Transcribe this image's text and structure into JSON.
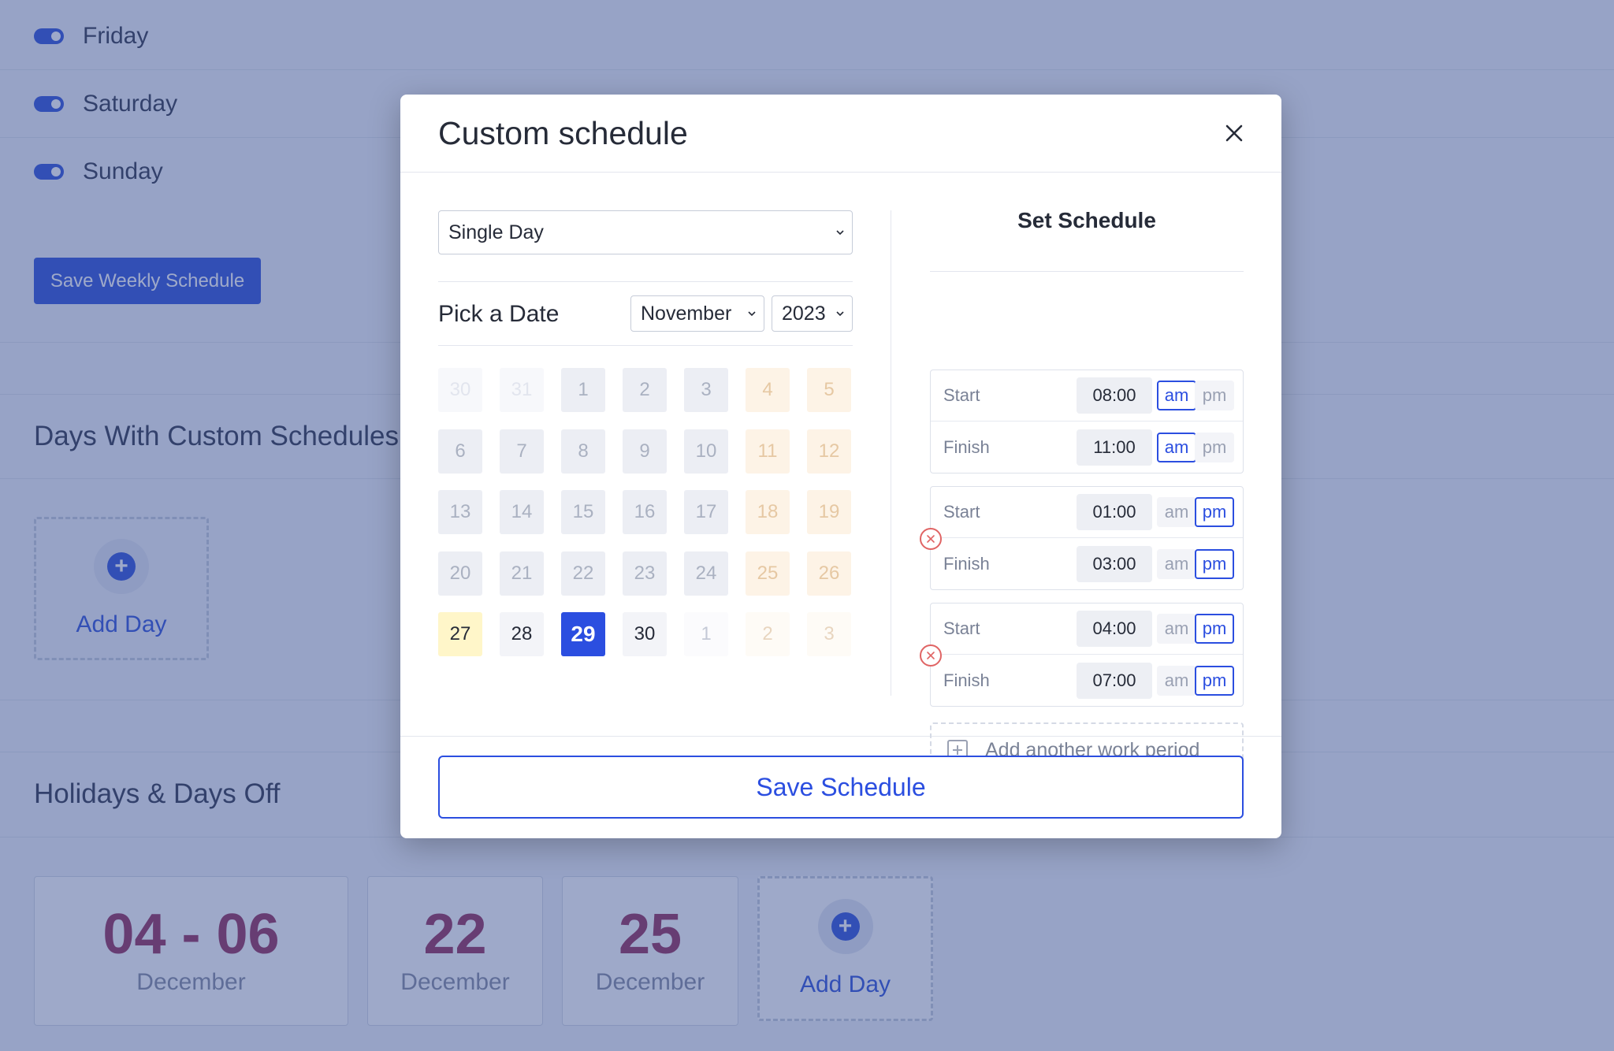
{
  "background": {
    "days": [
      {
        "name": "Friday"
      },
      {
        "name": "Saturday"
      },
      {
        "name": "Sunday"
      }
    ],
    "save_weekly_label": "Save Weekly Schedule",
    "custom_section_title": "Days With Custom Schedules",
    "add_day_label": "Add Day",
    "holidays_title": "Holidays & Days Off",
    "holidays": [
      {
        "num": "04 - 06",
        "month": "December"
      },
      {
        "num": "22",
        "month": "December"
      },
      {
        "num": "25",
        "month": "December"
      }
    ],
    "holiday_add_label": "Add Day"
  },
  "modal": {
    "title": "Custom schedule",
    "mode_select": "Single Day",
    "pick_label": "Pick a Date",
    "month_select": "November",
    "year_select": "2023",
    "calendar": [
      [
        "30",
        "31",
        "1",
        "2",
        "3",
        "4",
        "5"
      ],
      [
        "6",
        "7",
        "8",
        "9",
        "10",
        "11",
        "12"
      ],
      [
        "13",
        "14",
        "15",
        "16",
        "17",
        "18",
        "19"
      ],
      [
        "20",
        "21",
        "22",
        "23",
        "24",
        "25",
        "26"
      ],
      [
        "27",
        "28",
        "29",
        "30",
        "1",
        "2",
        "3"
      ]
    ],
    "selected_day": "29",
    "right_title": "Set Schedule",
    "start_label": "Start",
    "finish_label": "Finish",
    "am_label": "am",
    "pm_label": "pm",
    "periods": [
      {
        "start": "08:00",
        "start_ampm": "am",
        "finish": "11:00",
        "finish_ampm": "am"
      },
      {
        "start": "01:00",
        "start_ampm": "pm",
        "finish": "03:00",
        "finish_ampm": "pm"
      },
      {
        "start": "04:00",
        "start_ampm": "pm",
        "finish": "07:00",
        "finish_ampm": "pm"
      }
    ],
    "add_period_label": "Add another work period",
    "save_label": "Save Schedule"
  },
  "colors": {
    "accent": "#2b4ee0",
    "overlay": "#2f4a8a",
    "holiday_number": "#9c3b63",
    "remove_icon": "#e06464"
  }
}
